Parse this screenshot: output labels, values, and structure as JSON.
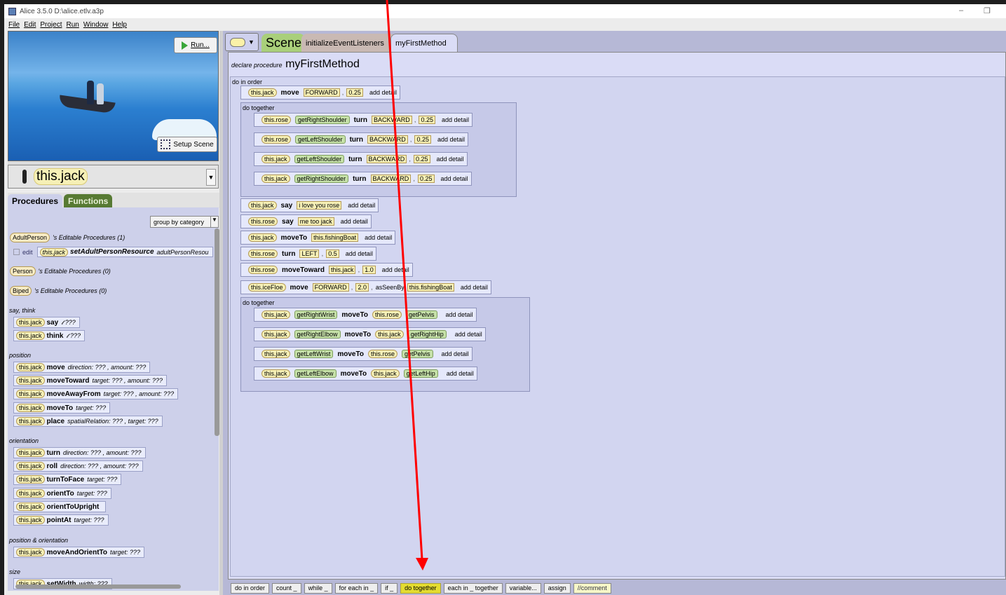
{
  "window": {
    "title": "Alice 3.5.0 D:\\alice.etlv.a3p",
    "minimize": "–",
    "restore": "❐"
  },
  "menu": [
    "File",
    "Edit",
    "Project",
    "Run",
    "Window",
    "Help"
  ],
  "scene_view": {
    "run_label": "Run...",
    "setup_label": "Setup Scene"
  },
  "selected_object": "this.jack",
  "panel_tabs": {
    "procedures": "Procedures",
    "functions": "Functions"
  },
  "group_by": "group by category",
  "classes": [
    {
      "name": "AdultPerson",
      "suffix": "'s Editable Procedures (1)"
    },
    {
      "name": "Person",
      "suffix": "'s Editable Procedures (0)"
    },
    {
      "name": "Biped",
      "suffix": "'s Editable Procedures (0)"
    }
  ],
  "editable": {
    "edit": "edit",
    "obj": "this.jack",
    "method": "setAdultPersonResource",
    "param": "adultPersonResou"
  },
  "sections": {
    "say_think": "say, think",
    "position": "position",
    "orientation": "orientation",
    "pos_orient": "position & orientation",
    "size": "size"
  },
  "tiles": [
    {
      "obj": "this.jack",
      "m": "say",
      "rest": "𝓉 ???"
    },
    {
      "obj": "this.jack",
      "m": "think",
      "rest": "𝓉 ???"
    },
    {
      "obj": "this.jack",
      "m": "move",
      "rest": "direction: ??? , amount: ???"
    },
    {
      "obj": "this.jack",
      "m": "moveToward",
      "rest": "target: ??? , amount: ???"
    },
    {
      "obj": "this.jack",
      "m": "moveAwayFrom",
      "rest": "target: ??? , amount: ???"
    },
    {
      "obj": "this.jack",
      "m": "moveTo",
      "rest": "target: ???"
    },
    {
      "obj": "this.jack",
      "m": "place",
      "rest": "spatialRelation: ??? , target: ???"
    },
    {
      "obj": "this.jack",
      "m": "turn",
      "rest": "direction: ??? , amount: ???"
    },
    {
      "obj": "this.jack",
      "m": "roll",
      "rest": "direction: ??? , amount: ???"
    },
    {
      "obj": "this.jack",
      "m": "turnToFace",
      "rest": "target: ???"
    },
    {
      "obj": "this.jack",
      "m": "orientTo",
      "rest": "target: ???"
    },
    {
      "obj": "this.jack",
      "m": "orientToUpright",
      "rest": ""
    },
    {
      "obj": "this.jack",
      "m": "pointAt",
      "rest": "target: ???"
    },
    {
      "obj": "this.jack",
      "m": "moveAndOrientTo",
      "rest": "target: ???"
    },
    {
      "obj": "this.jack",
      "m": "setWidth",
      "rest": "width: ???"
    }
  ],
  "editor_tabs": {
    "scene": "Scene",
    "init": "initializeEventListeners",
    "method": "myFirstMethod"
  },
  "declare": {
    "prefix": "declare procedure",
    "name": "myFirstMethod"
  },
  "do_in_order": "do in order",
  "do_together": "do together",
  "add_detail": "add detail",
  "statements": {
    "s1": {
      "obj": "this.jack",
      "verb": "move",
      "a1": "FORWARD",
      "a2": "0.25"
    },
    "t1": [
      {
        "obj": "this.rose",
        "fn": "getRightShoulder",
        "verb": "turn",
        "a1": "BACKWARD",
        "a2": "0.25"
      },
      {
        "obj": "this.rose",
        "fn": "getLeftShoulder",
        "verb": "turn",
        "a1": "BACKWARD",
        "a2": "0.25"
      },
      {
        "obj": "this.jack",
        "fn": "getLeftShoulder",
        "verb": "turn",
        "a1": "BACKWARD",
        "a2": "0.25"
      },
      {
        "obj": "this.jack",
        "fn": "getRightShoulder",
        "verb": "turn",
        "a1": "BACKWARD",
        "a2": "0.25"
      }
    ],
    "s2": {
      "obj": "this.jack",
      "verb": "say",
      "a1": "i love you rose"
    },
    "s3": {
      "obj": "this.rose",
      "verb": "say",
      "a1": "me too jack"
    },
    "s4": {
      "obj": "this.jack",
      "verb": "moveTo",
      "a1": "this.fishingBoat"
    },
    "s5": {
      "obj": "this.rose",
      "verb": "turn",
      "a1": "LEFT",
      "a2": "0.5"
    },
    "s6": {
      "obj": "this.rose",
      "verb": "moveToward",
      "a1": "this.jack",
      "a2": "1.0"
    },
    "s7": {
      "obj": "this.iceFloe",
      "verb": "move",
      "a1": "FORWARD",
      "a2": "2.0",
      "kw": "asSeenBy",
      "a3": "this.fishingBoat"
    },
    "t2": [
      {
        "obj": "this.jack",
        "fn": "getRightWrist",
        "verb": "moveTo",
        "tobj": "this.rose",
        "tfn": "getPelvis"
      },
      {
        "obj": "this.jack",
        "fn": "getRightElbow",
        "verb": "moveTo",
        "tobj": "this.jack",
        "tfn": "getRightHip"
      },
      {
        "obj": "this.jack",
        "fn": "getLeftWrist",
        "verb": "moveTo",
        "tobj": "this.rose",
        "tfn": "getPelvis"
      },
      {
        "obj": "this.jack",
        "fn": "getLeftElbow",
        "verb": "moveTo",
        "tobj": "this.jack",
        "tfn": "getLeftHip"
      }
    ]
  },
  "bottom_bar": [
    "do in order",
    "count _",
    "while _",
    "for each in _",
    "if _",
    "do together",
    "each in _ together",
    "variable...",
    "assign",
    "//comment"
  ],
  "annotation": {
    "arrow_color": "#ff0000",
    "highlight_color": "#dcd218"
  }
}
